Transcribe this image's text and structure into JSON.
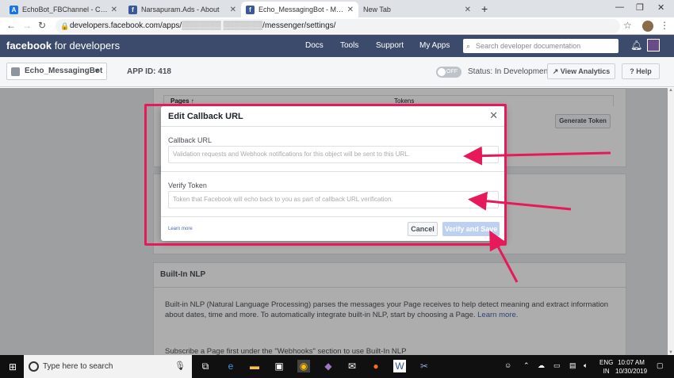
{
  "tabs": [
    {
      "label": "EchoBot_FBChannel - Channels - "
    },
    {
      "label": "Narsapuram.Ads - About"
    },
    {
      "label": "Echo_MessagingBot - Messenger"
    },
    {
      "label": "New Tab"
    }
  ],
  "address": {
    "url_main": "developers.facebook.com/apps/",
    "url_rest": "/messenger/settings/"
  },
  "fb_header": {
    "logo_bold": "facebook",
    "logo_rest": " for developers",
    "nav": [
      "Docs",
      "Tools",
      "Support",
      "My Apps"
    ],
    "search_placeholder": "Search developer documentation"
  },
  "app_bar": {
    "app_name": "Echo_MessagingBot",
    "app_id_label": "APP ID: 418",
    "toggle_label": "OFF",
    "status": "Status: In Development",
    "view_analytics": "View Analytics",
    "help": "Help"
  },
  "tokens_table": {
    "col_pages": "Pages ↑",
    "col_tokens": "Tokens",
    "generate_token": "Generate Token"
  },
  "builtin_nlp": {
    "title": "Built-In NLP",
    "description": "Built-in NLP (Natural Language Processing) parses the messages your Page receives to help detect meaning and extract information about dates, time and more. To automatically integrate built-in NLP, start by choosing a Page.",
    "learn_more": "Learn more.",
    "subscribe_note": "Subscribe a Page first under the \"Webhooks\" section to use Built-In NLP"
  },
  "modal": {
    "title": "Edit Callback URL",
    "callback_label": "Callback URL",
    "callback_placeholder": "Validation requests and Webhook notifications for this object will be sent to this URL.",
    "verify_label": "Verify Token",
    "verify_placeholder": "Token that Facebook will echo back to you as part of callback URL verification.",
    "learn_more": "Learn more",
    "cancel": "Cancel",
    "verify_save": "Verify and Save"
  },
  "annotation_color": "#e7195a",
  "taskbar": {
    "search_placeholder": "Type here to search",
    "lang": "ENG",
    "region": "IN",
    "time": "10:07 AM",
    "date": "10/30/2019"
  }
}
